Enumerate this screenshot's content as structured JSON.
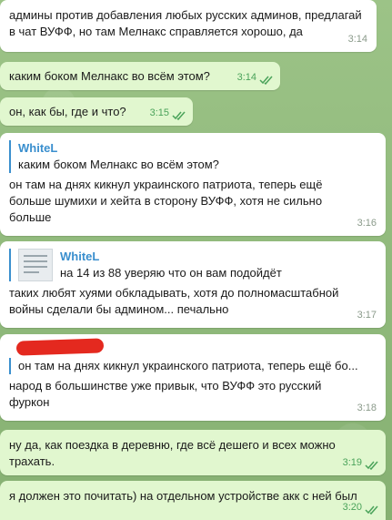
{
  "messages": [
    {
      "id": "m1",
      "direction": "in",
      "text": "админы против добавления любых русских админов, предлагай\nв чат ВУФФ, но там Мелнакс справляется хорошо, да",
      "time": "3:14"
    },
    {
      "id": "m2",
      "direction": "out",
      "text": "каким боком Мелнакс во всём этом?",
      "time": "3:14"
    },
    {
      "id": "m3",
      "direction": "out",
      "text": "он, как бы, где и что?",
      "time": "3:15"
    },
    {
      "id": "m4",
      "direction": "in",
      "reply_name": "WhiteL",
      "reply_text": "каким боком Мелнакс во всём этом?",
      "text": "он там на днях кикнул украинского патриота, теперь ещё\nбольше шумихи и хейта в сторону ВУФФ, хотя не сильно\nбольше",
      "time": "3:16"
    },
    {
      "id": "m5",
      "direction": "in",
      "reply_name": "WhiteL",
      "reply_text": "на 14 из 88 уверяю что он вам подойдёт",
      "text": "таких любят хуями обкладывать, хотя до полномасштабной\nвойны сделали бы админом... печально",
      "time": "3:17"
    },
    {
      "id": "m6",
      "direction": "in",
      "reply_text": "он там на днях кикнул украинского патриота, теперь ещё бо...",
      "text": "народ в большинстве уже привык, что ВУФФ это русский\nфуркон",
      "time": "3:18"
    },
    {
      "id": "m7",
      "direction": "out",
      "text": "ну да, как поездка в деревню, где всё дешего и всех можно\nтрахать.",
      "time": "3:19"
    },
    {
      "id": "m8",
      "direction": "out",
      "text": "я должен это почитать) на отдельном устройстве акк с ней был",
      "time": "3:20"
    }
  ],
  "colors": {
    "incoming": "#ffffff",
    "outgoing": "#e1f7cf",
    "accent": "#3a8fce",
    "check": "#4aa35a"
  }
}
